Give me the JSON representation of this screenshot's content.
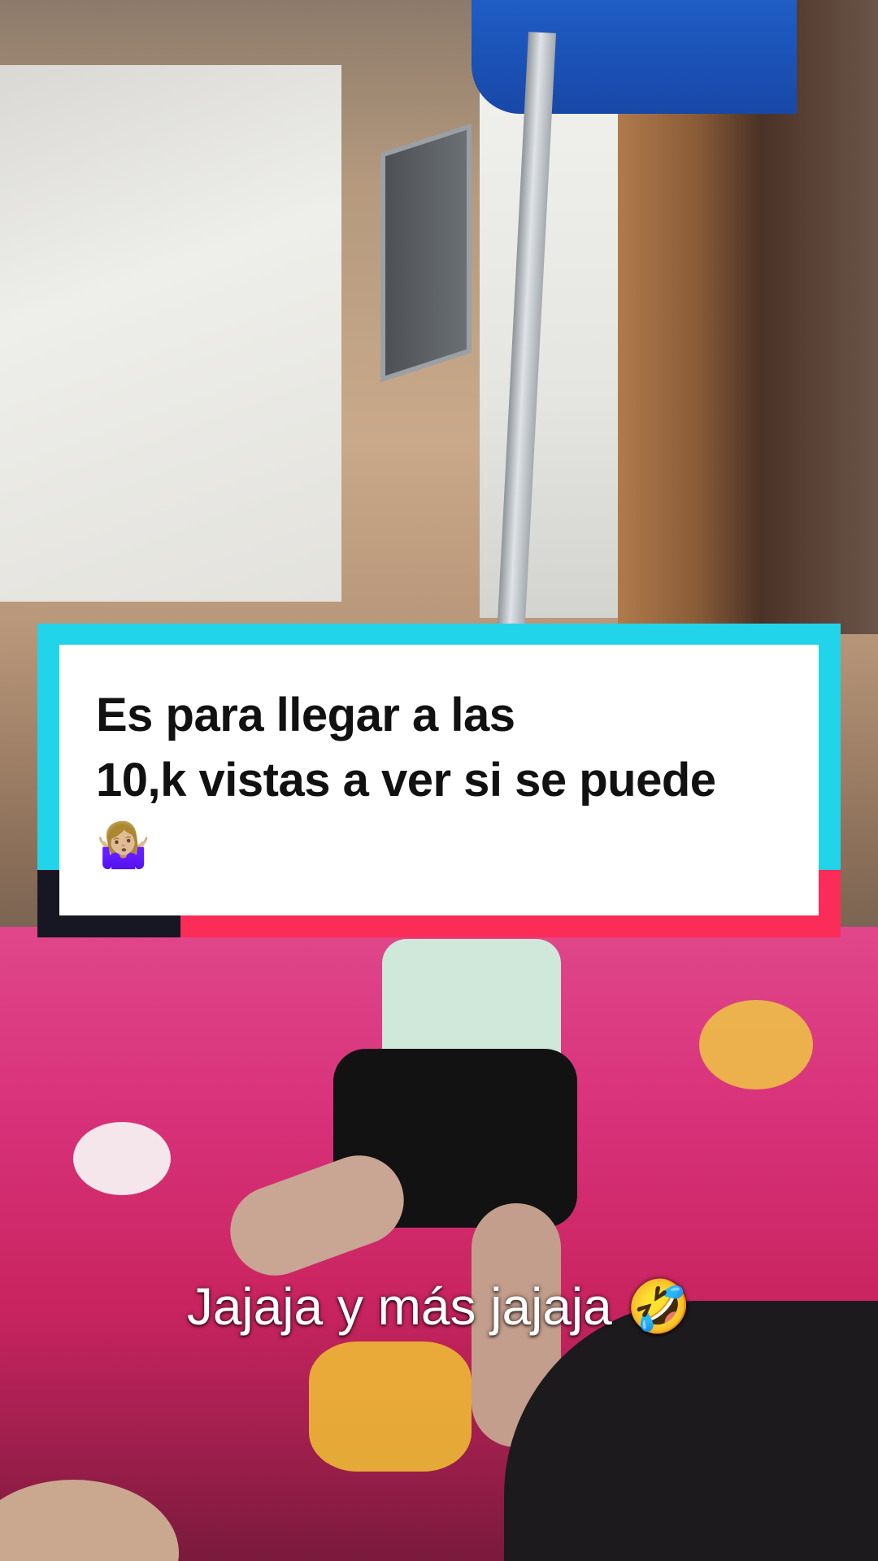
{
  "caption_card": {
    "line1": "Es para llegar a las",
    "line2": "10,k vistas a ver si se puede",
    "emoji": "🤷🏼‍♀️",
    "colors": {
      "border_cyan": "#21d4ea",
      "border_red": "#fb2c57",
      "border_dark": "#171723",
      "fill": "#ffffff"
    }
  },
  "subtitle": {
    "text": "Jajaja y más jajaja 🤣"
  }
}
